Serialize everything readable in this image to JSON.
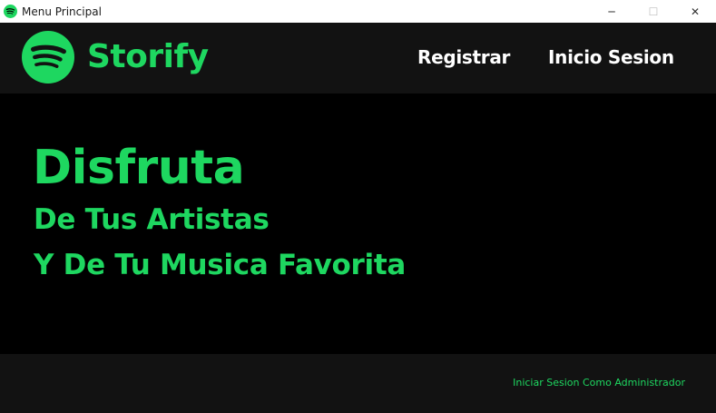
{
  "window": {
    "title": "Menu Principal",
    "icon": "spotify-logo-icon",
    "controls": {
      "minimize": "─",
      "maximize": "☐",
      "close": "✕"
    }
  },
  "header": {
    "brand": "Storify",
    "logo_icon": "spotify-logo-icon",
    "nav": {
      "register": "Registrar",
      "login": "Inicio Sesion"
    }
  },
  "hero": {
    "title": "Disfruta",
    "line1": "De Tus Artistas",
    "line2": "Y De Tu Musica Favorita"
  },
  "footer": {
    "admin_link": "Iniciar Sesion Como Administrador"
  },
  "colors": {
    "accent": "#1ed760",
    "header_bg": "#121212",
    "body_bg": "#000000",
    "nav_text": "#ffffff"
  }
}
